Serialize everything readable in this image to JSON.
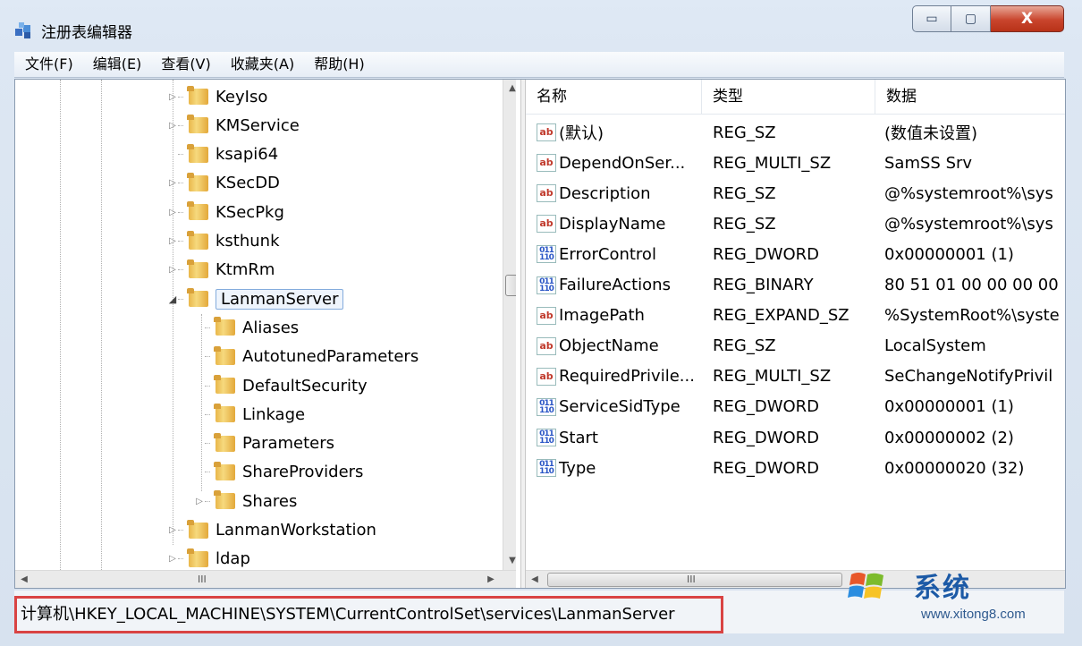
{
  "window": {
    "title": "注册表编辑器"
  },
  "caption": {
    "minimize": "▭",
    "maximize": "▢",
    "close": "X"
  },
  "menu": [
    "文件(F)",
    "编辑(E)",
    "查看(V)",
    "收藏夹(A)",
    "帮助(H)"
  ],
  "tree": {
    "items": [
      {
        "label": "KeyIso",
        "expander": "▷",
        "level": 0
      },
      {
        "label": "KMService",
        "expander": "▷",
        "level": 0
      },
      {
        "label": "ksapi64",
        "expander": "",
        "level": 0
      },
      {
        "label": "KSecDD",
        "expander": "▷",
        "level": 0
      },
      {
        "label": "KSecPkg",
        "expander": "▷",
        "level": 0
      },
      {
        "label": "ksthunk",
        "expander": "▷",
        "level": 0
      },
      {
        "label": "KtmRm",
        "expander": "▷",
        "level": 0
      },
      {
        "label": "LanmanServer",
        "expander": "◢",
        "level": 0,
        "selected": true
      },
      {
        "label": "Aliases",
        "expander": "",
        "level": 1
      },
      {
        "label": "AutotunedParameters",
        "expander": "",
        "level": 1
      },
      {
        "label": "DefaultSecurity",
        "expander": "",
        "level": 1
      },
      {
        "label": "Linkage",
        "expander": "",
        "level": 1
      },
      {
        "label": "Parameters",
        "expander": "",
        "level": 1
      },
      {
        "label": "ShareProviders",
        "expander": "",
        "level": 1
      },
      {
        "label": "Shares",
        "expander": "▷",
        "level": 1
      },
      {
        "label": "LanmanWorkstation",
        "expander": "▷",
        "level": 0
      },
      {
        "label": "ldap",
        "expander": "▷",
        "level": 0
      }
    ],
    "scroll_up": "▲",
    "scroll_down": "▼",
    "scroll_left": "◀",
    "scroll_right": "▶",
    "hgrip": "III"
  },
  "list": {
    "columns": {
      "name": "名称",
      "type": "类型",
      "data": "数据"
    },
    "rows": [
      {
        "icon": "string-value-icon",
        "glyph": "ab",
        "name": "(默认)",
        "type": "REG_SZ",
        "data": "(数值未设置)"
      },
      {
        "icon": "string-value-icon",
        "glyph": "ab",
        "name": "DependOnSer...",
        "type": "REG_MULTI_SZ",
        "data": "SamSS Srv"
      },
      {
        "icon": "string-value-icon",
        "glyph": "ab",
        "name": "Description",
        "type": "REG_SZ",
        "data": "@%systemroot%\\sys"
      },
      {
        "icon": "string-value-icon",
        "glyph": "ab",
        "name": "DisplayName",
        "type": "REG_SZ",
        "data": "@%systemroot%\\sys"
      },
      {
        "icon": "binary-value-icon",
        "glyph": "011\n110",
        "name": "ErrorControl",
        "type": "REG_DWORD",
        "data": "0x00000001 (1)"
      },
      {
        "icon": "binary-value-icon",
        "glyph": "011\n110",
        "name": "FailureActions",
        "type": "REG_BINARY",
        "data": "80 51 01 00 00 00 00"
      },
      {
        "icon": "string-value-icon",
        "glyph": "ab",
        "name": "ImagePath",
        "type": "REG_EXPAND_SZ",
        "data": "%SystemRoot%\\syste"
      },
      {
        "icon": "string-value-icon",
        "glyph": "ab",
        "name": "ObjectName",
        "type": "REG_SZ",
        "data": "LocalSystem"
      },
      {
        "icon": "string-value-icon",
        "glyph": "ab",
        "name": "RequiredPrivile...",
        "type": "REG_MULTI_SZ",
        "data": "SeChangeNotifyPrivil"
      },
      {
        "icon": "binary-value-icon",
        "glyph": "011\n110",
        "name": "ServiceSidType",
        "type": "REG_DWORD",
        "data": "0x00000001 (1)"
      },
      {
        "icon": "binary-value-icon",
        "glyph": "011\n110",
        "name": "Start",
        "type": "REG_DWORD",
        "data": "0x00000002 (2)"
      },
      {
        "icon": "binary-value-icon",
        "glyph": "011\n110",
        "name": "Type",
        "type": "REG_DWORD",
        "data": "0x00000020 (32)"
      }
    ],
    "hgrip": "III"
  },
  "status": {
    "path": "计算机\\HKEY_LOCAL_MACHINE\\SYSTEM\\CurrentControlSet\\services\\LanmanServer"
  },
  "watermark": {
    "text": "系统",
    "url": "www.xitong8.com"
  }
}
